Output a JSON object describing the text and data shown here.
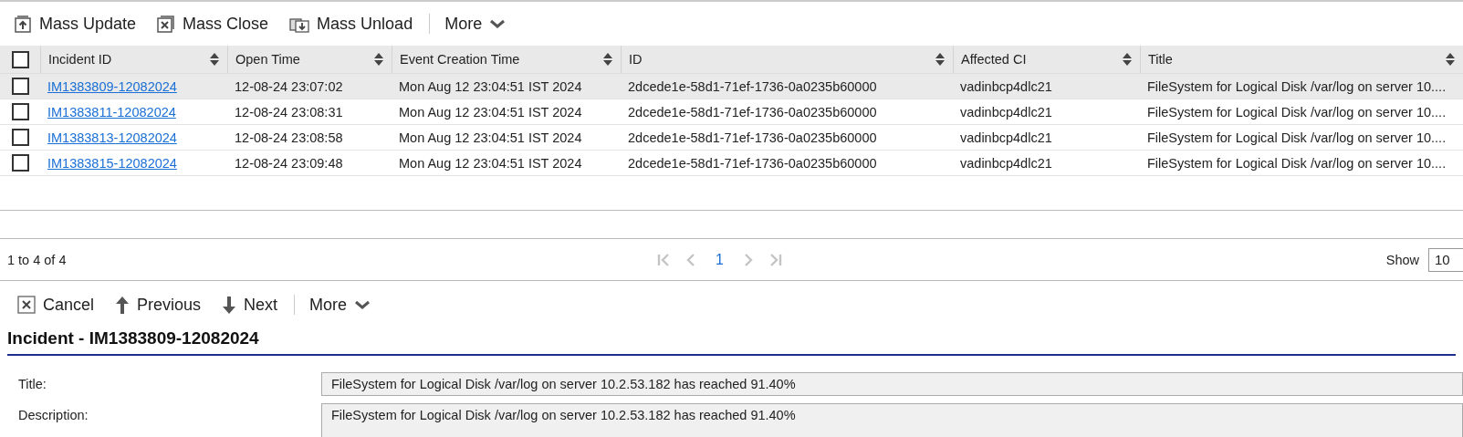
{
  "list_toolbar": [
    {
      "label": "Mass Update",
      "kind": "action"
    },
    {
      "label": "Mass Close",
      "kind": "action"
    },
    {
      "label": "Mass Unload",
      "kind": "action"
    },
    {
      "label": "More",
      "kind": "menu"
    }
  ],
  "table": {
    "select_all": {
      "checked": false
    },
    "columns": [
      "Incident ID",
      "Open Time",
      "Event Creation Time",
      "ID",
      "Affected CI",
      "Title"
    ],
    "rows": [
      {
        "selected": true,
        "checked": false,
        "cells": [
          "IM1383809-12082024",
          "12-08-24 23:07:02",
          "Mon Aug 12 23:04:51 IST 2024",
          "2dcede1e-58d1-71ef-1736-0a0235b60000",
          "vadinbcp4dlc21",
          "FileSystem for Logical Disk /var/log on server 10...."
        ]
      },
      {
        "selected": false,
        "checked": false,
        "cells": [
          "IM1383811-12082024",
          "12-08-24 23:08:31",
          "Mon Aug 12 23:04:51 IST 2024",
          "2dcede1e-58d1-71ef-1736-0a0235b60000",
          "vadinbcp4dlc21",
          "FileSystem for Logical Disk /var/log on server 10...."
        ]
      },
      {
        "selected": false,
        "checked": false,
        "cells": [
          "IM1383813-12082024",
          "12-08-24 23:08:58",
          "Mon Aug 12 23:04:51 IST 2024",
          "2dcede1e-58d1-71ef-1736-0a0235b60000",
          "vadinbcp4dlc21",
          "FileSystem for Logical Disk /var/log on server 10...."
        ]
      },
      {
        "selected": false,
        "checked": false,
        "cells": [
          "IM1383815-12082024",
          "12-08-24 23:09:48",
          "Mon Aug 12 23:04:51 IST 2024",
          "2dcede1e-58d1-71ef-1736-0a0235b60000",
          "vadinbcp4dlc21",
          "FileSystem for Logical Disk /var/log on server 10...."
        ]
      }
    ]
  },
  "pager": {
    "summary": "1 to 4 of 4",
    "pages": [
      {
        "label": "1",
        "selected": true
      }
    ],
    "first": {
      "disabled": true
    },
    "previous": {
      "disabled": true
    },
    "next": {
      "disabled": true
    },
    "last": {
      "disabled": true
    },
    "show_label": "Show",
    "show_value": "10"
  },
  "detail_toolbar": [
    {
      "label": "Cancel",
      "kind": "action"
    },
    {
      "label": "Previous",
      "kind": "action"
    },
    {
      "label": "Next",
      "kind": "action"
    },
    {
      "label": "More",
      "kind": "menu"
    }
  ],
  "detail": {
    "heading": "Incident - IM1383809-12082024",
    "fields": [
      {
        "label": "Title:",
        "value": "FileSystem for Logical Disk  /var/log on server 10.2.53.182 has reached 91.40%",
        "kind": "input"
      },
      {
        "label": "Description:",
        "value": "FileSystem for Logical Disk  /var/log on server 10.2.53.182 has reached 91.40%",
        "kind": "textarea"
      }
    ]
  }
}
